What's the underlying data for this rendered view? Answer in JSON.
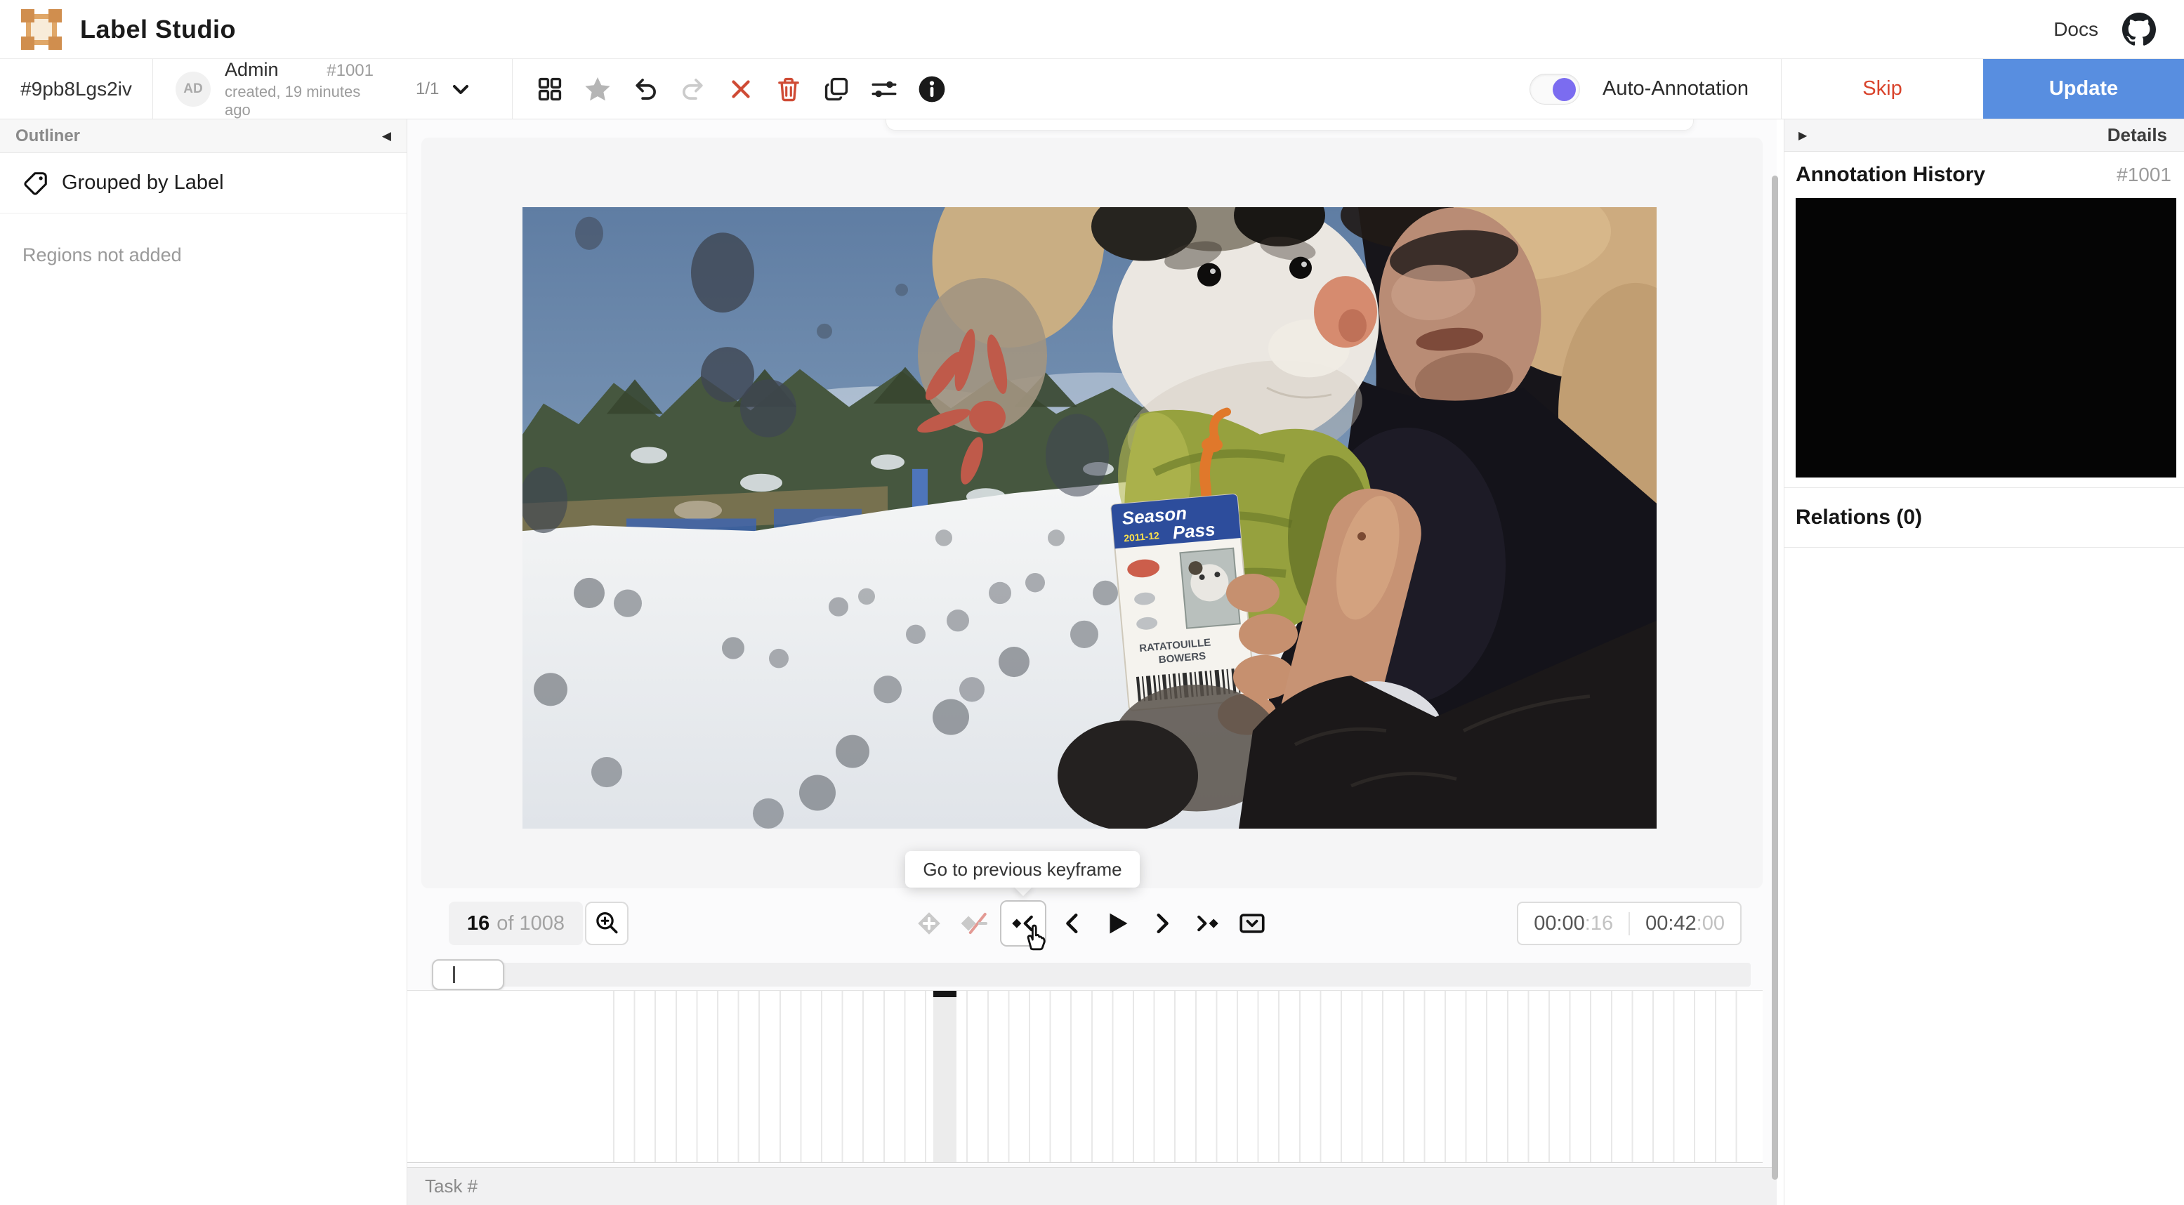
{
  "app": {
    "title": "Label Studio",
    "docs_label": "Docs"
  },
  "taskbar": {
    "task_id": "#9pb8Lgs2iv",
    "avatar_initials": "AD",
    "annotator_name": "Admin",
    "annotation_id": "#1001",
    "created_info": "created, 19 minutes ago",
    "pagination": "1/1"
  },
  "actions": {
    "auto_annotation": "Auto-Annotation",
    "skip": "Skip",
    "update": "Update"
  },
  "sidebar": {
    "header": "Outliner",
    "group_mode": "Grouped by Label",
    "empty_message": "Regions not added"
  },
  "details_panel": {
    "header": "Details",
    "history_title": "Annotation History",
    "history_id": "#1001",
    "relations_title": "Relations (0)"
  },
  "player": {
    "frame_current": "16",
    "frame_total_label": "of 1008",
    "tooltip": "Go to previous keyframe",
    "time_position": "00:00",
    "time_position_frames": ":16",
    "time_total": "00:42",
    "time_total_frames": ":00"
  },
  "video_overlay": {
    "pass_line1": "Season",
    "pass_line2": "Pass",
    "pass_season": "2011-12",
    "pass_name1": "RATATOUILLE",
    "pass_name2": "BOWERS"
  },
  "footer": {
    "task_label": "Task #"
  },
  "colors": {
    "update_blue": "#588ee0",
    "danger_red": "#cf4b35",
    "toggle_purple": "#7b6cf0",
    "logo_orange": "#d99a5b"
  }
}
